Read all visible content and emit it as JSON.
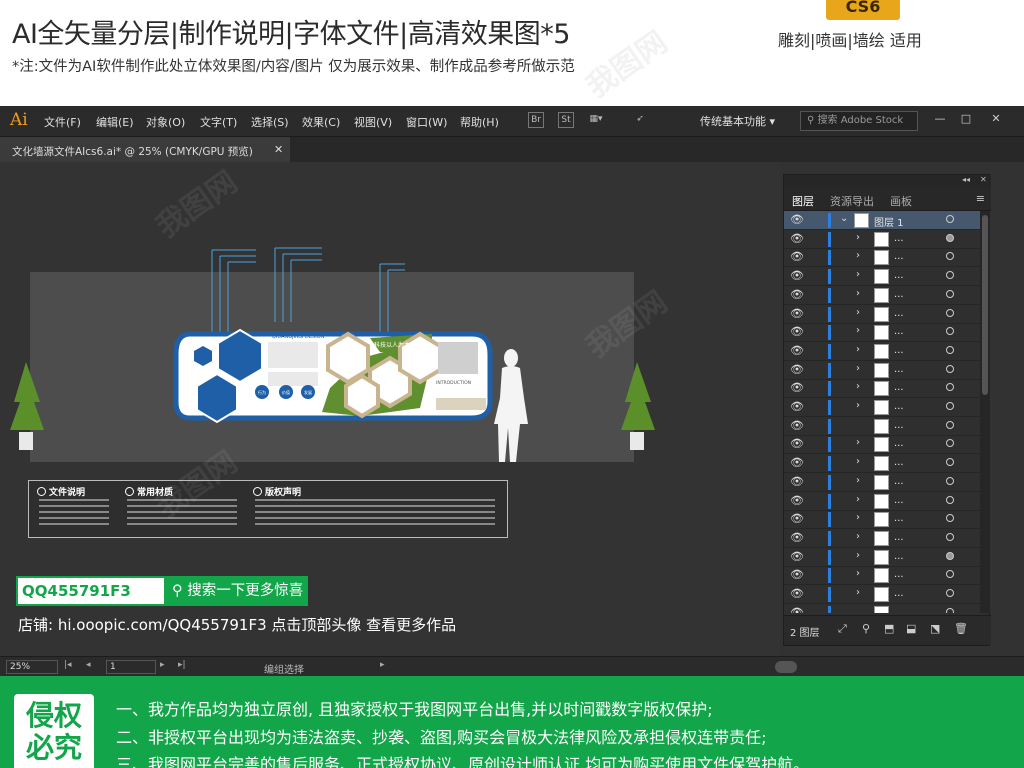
{
  "banner": {
    "title": "AI全矢量分层|制作说明|字体文件|高清效果图*5",
    "note": "*注:文件为AI软件制作此处立体效果图/内容/图片 仅为展示效果、制作成品参考所做示范",
    "version": "CS6",
    "usage": "雕刻|喷画|墙绘 适用"
  },
  "app": {
    "logo": "Ai",
    "menu": [
      "文件(F)",
      "编辑(E)",
      "对象(O)",
      "文字(T)",
      "选择(S)",
      "效果(C)",
      "视图(V)",
      "窗口(W)",
      "帮助(H)"
    ],
    "toolbar_icons": [
      "Br",
      "St"
    ],
    "workspace": "传统基本功能 ▾",
    "stock_search_placeholder": "搜索 Adobe Stock",
    "window_buttons": [
      "—",
      "□",
      "✕"
    ]
  },
  "document_tab": {
    "label": "文化墙源文件AIcs6.ai* @ 25% (CMYK/GPU 预览)",
    "close": "✕"
  },
  "artwork": {
    "company": "QIUANGJINSI DESIGN",
    "slogan": "科技以人为本",
    "heading": "INTRODUCTION",
    "buttons": [
      "行为",
      "价值",
      "发展"
    ]
  },
  "info_panel": {
    "sections": [
      "文件说明",
      "常用材质",
      "版权声明"
    ]
  },
  "promo": {
    "qq": "QQ455791F3",
    "search_label": "搜索一下更多惊喜",
    "shop_line": "店铺: hi.ooopic.com/QQ455791F3  点击顶部头像 查看更多作品"
  },
  "layers_panel": {
    "tabs": [
      "图层",
      "资源导出",
      "画板"
    ],
    "active_tab": "图层",
    "menu_icon": "≡",
    "collapse_icons": [
      "◂◂",
      "✕"
    ],
    "top_layer_name": "图层 1",
    "sublayer_name": "...",
    "sublayer_count": 21,
    "count_label": "2 图层",
    "footer_icons": [
      "⤢",
      "⚲",
      "⬒",
      "⬓",
      "⬔",
      "⬕",
      "🗑"
    ]
  },
  "status": {
    "zoom": "25%",
    "page": "1",
    "tool": "编组选择"
  },
  "legal": {
    "badge_line1": "侵权",
    "badge_line2": "必究",
    "lines": [
      "一、我方作品均为独立原创, 且独家授权于我图网平台出售,并以时间戳数字版权保护;",
      "二、非授权平台出现均为违法盗卖、抄袭、盗图,购买会冒极大法律风险及承担侵权连带责任;",
      "三、我图网平台完善的售后服务、正式授权协议、原创设计师认证,均可为购买使用文件保驾护航。"
    ]
  },
  "colors": {
    "brand_green": "#13a54a",
    "ai_orange": "#f29b1b",
    "design_blue": "#1e5fa8",
    "design_green": "#5f8f2e",
    "design_tan": "#c8b58f"
  }
}
